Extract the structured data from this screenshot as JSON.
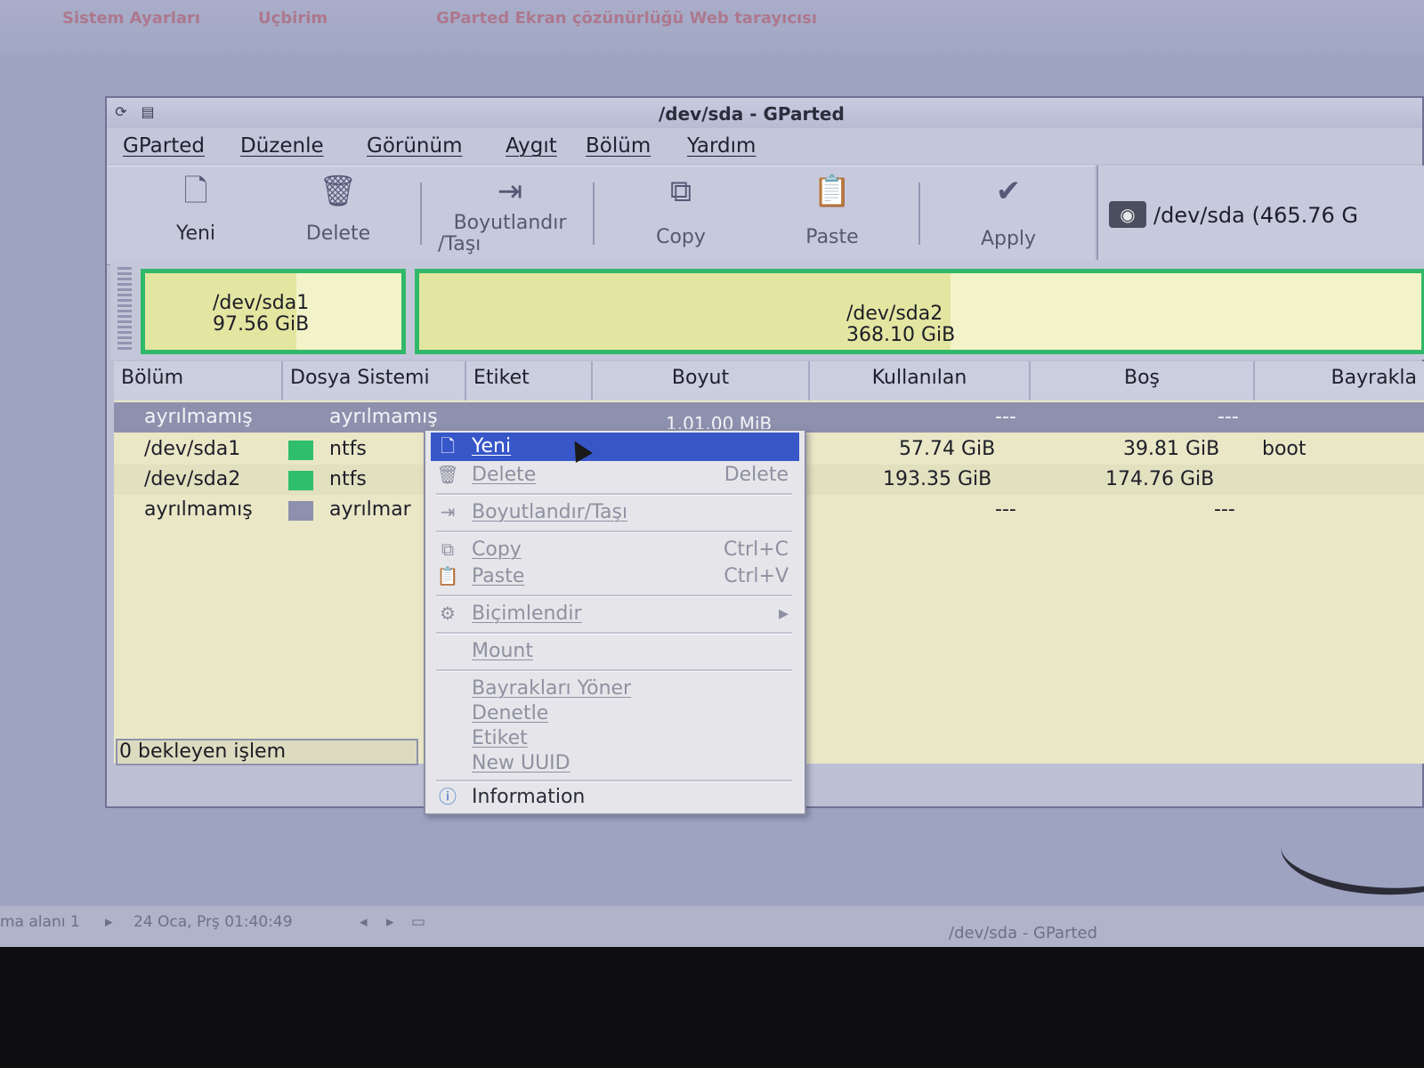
{
  "desktop": {
    "top_links": [
      "Sistem Ayarları",
      "Uçbirim",
      "GParted  Ekran çözünürlüğü Web tarayıcısı"
    ]
  },
  "window": {
    "title": "/dev/sda - GParted",
    "menu": [
      "GParted",
      "Düzenle",
      "Görünüm",
      "Aygıt",
      "Bölüm",
      "Yardım"
    ]
  },
  "toolbar": {
    "new_label": "Yeni",
    "delete_label": "Delete",
    "resize_label_1": "Boyutlandır",
    "resize_label_2": "/Taşı",
    "copy_label": "Copy",
    "paste_label": "Paste",
    "apply_label": "Apply"
  },
  "device": {
    "label": "/dev/sda  (465.76 G"
  },
  "partition_bar": {
    "sda1_name": "/dev/sda1",
    "sda1_size": "97.56 GiB",
    "sda2_name": "/dev/sda2",
    "sda2_size": "368.10 GiB",
    "sda1_used_fraction": 0.59,
    "sda2_used_fraction": 0.53,
    "used_color": "#e3e6a1",
    "free_color": "#f2f3c8",
    "border_color": "#31b86a"
  },
  "table": {
    "headers": [
      "Bölüm",
      "Dosya Sistemi",
      "Etiket",
      "Boyut",
      "Kullanılan",
      "Boş",
      "Bayrakla"
    ],
    "rows": [
      {
        "partition": "ayrılmamış",
        "fs": "ayrılmamış",
        "fs_color": "#8d91ae",
        "size": "1.01.00 MiB",
        "used": "---",
        "free": "---",
        "flags": ""
      },
      {
        "partition": "/dev/sda1",
        "fs": "ntfs",
        "fs_color": "#2fbf6a",
        "size": "",
        "used": "57.74 GiB",
        "free": "39.81 GiB",
        "flags": "boot"
      },
      {
        "partition": "/dev/sda2",
        "fs": "ntfs",
        "fs_color": "#2fbf6a",
        "size": "",
        "used": "193.35 GiB",
        "free": "174.76 GiB",
        "flags": ""
      },
      {
        "partition": "ayrılmamış",
        "fs": "ayrılmar",
        "fs_color": "#8d91ae",
        "size": "",
        "used": "---",
        "free": "---",
        "flags": ""
      }
    ]
  },
  "status": {
    "pending": "0 bekleyen işlem"
  },
  "context_menu": {
    "items": [
      {
        "label": "Yeni",
        "shortcut": ""
      },
      {
        "label": "Delete",
        "shortcut": "Delete"
      },
      {
        "label": "Boyutlandır/Taşı",
        "shortcut": ""
      },
      {
        "label": "Copy",
        "shortcut": "Ctrl+C"
      },
      {
        "label": "Paste",
        "shortcut": "Ctrl+V"
      },
      {
        "label": "Biçimlendir",
        "shortcut": ""
      },
      {
        "label": "Mount",
        "shortcut": ""
      },
      {
        "label": "Bayrakları Yöner",
        "shortcut": ""
      },
      {
        "label": "Denetle",
        "shortcut": ""
      },
      {
        "label": "Etiket",
        "shortcut": ""
      },
      {
        "label": "New UUID",
        "shortcut": ""
      },
      {
        "label": "Information",
        "shortcut": ""
      }
    ],
    "active_color": "#3757c9"
  },
  "taskbar": {
    "workspace": "ma alanı 1",
    "datetime": "24 Oca, Prş 01:40:49",
    "window_label": "/dev/sda - GParted"
  }
}
